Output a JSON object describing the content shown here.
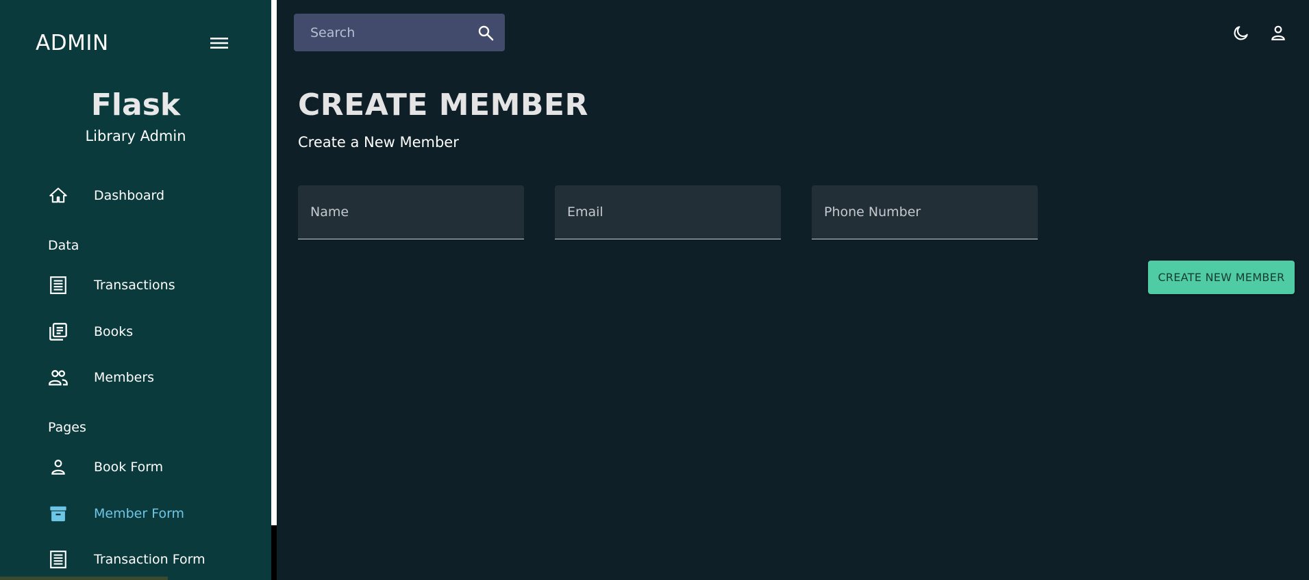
{
  "sidebar": {
    "brand": "ADMIN",
    "profile": {
      "name": "Flask",
      "role": "Library Admin"
    },
    "items": [
      {
        "label": "Dashboard",
        "icon": "home-icon"
      },
      {
        "label": "Transactions",
        "icon": "receipt-icon"
      },
      {
        "label": "Books",
        "icon": "library-books-icon"
      },
      {
        "label": "Members",
        "icon": "people-icon"
      },
      {
        "label": "Book Form",
        "icon": "person-icon"
      },
      {
        "label": "Member Form",
        "icon": "archive-icon",
        "active": true
      },
      {
        "label": "Transaction Form",
        "icon": "receipt-icon"
      }
    ],
    "sections": {
      "data": "Data",
      "pages": "Pages"
    }
  },
  "topbar": {
    "search_placeholder": "Search",
    "icons": [
      "search-icon",
      "dark-mode-icon",
      "person-icon"
    ]
  },
  "main": {
    "title": "CREATE MEMBER",
    "subtitle": "Create a New Member",
    "fields": {
      "name_placeholder": "Name",
      "email_placeholder": "Email",
      "phone_placeholder": "Phone Number"
    },
    "create_button": "CREATE NEW MEMBER"
  },
  "colors": {
    "sidebar_bg": "#0b3a3d",
    "main_bg": "#0f1f27",
    "accent": "#4fcca4",
    "active_nav": "#6ec6e6",
    "search_bg": "#424b6b"
  }
}
